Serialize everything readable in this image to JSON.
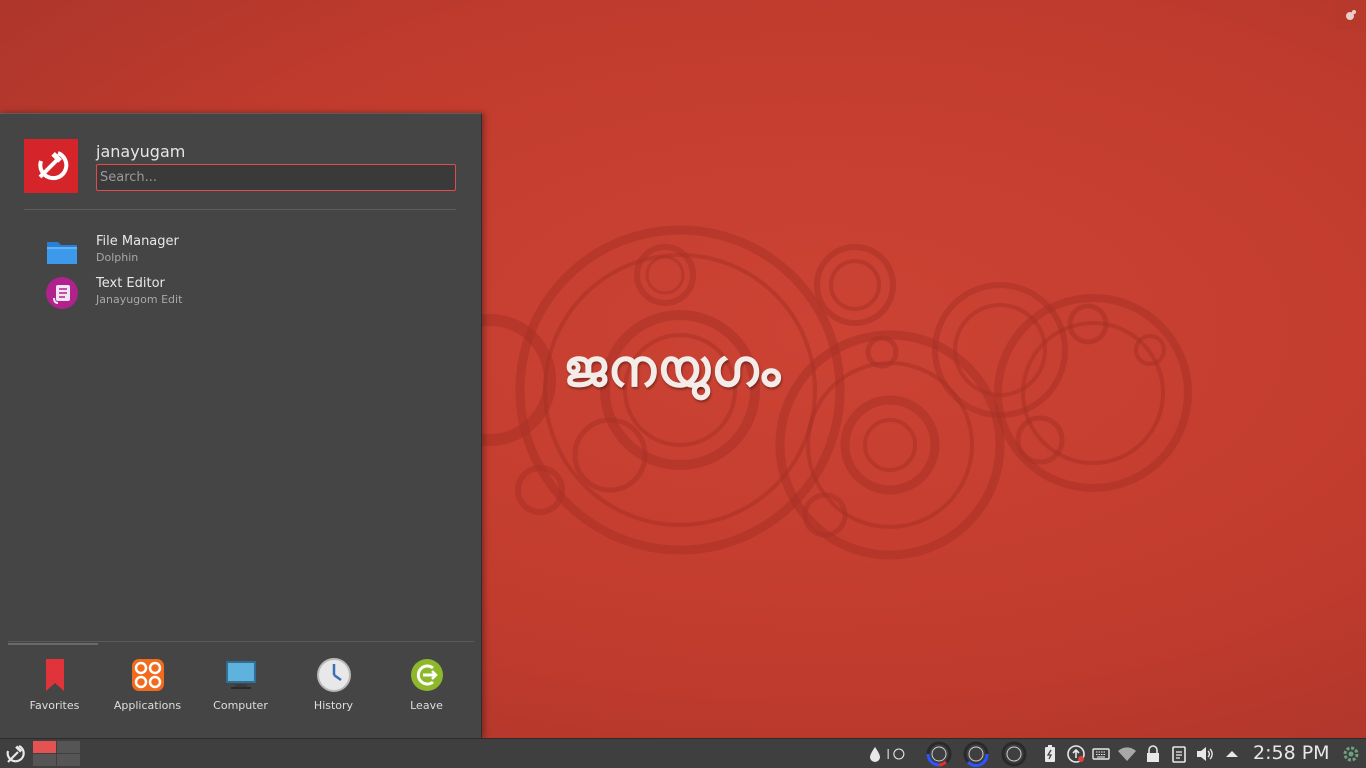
{
  "desktop": {
    "wallpaper_text": "ജനയുഗം"
  },
  "launcher": {
    "user_name": "janayugam",
    "search_placeholder": "Search...",
    "favorites": [
      {
        "name": "File Manager",
        "description": "Dolphin",
        "icon": "folder-icon"
      },
      {
        "name": "Text Editor",
        "description": "Janayugom Edit",
        "icon": "text-editor-icon"
      }
    ],
    "tabs": [
      {
        "label": "Favorites",
        "icon": "bookmark-icon"
      },
      {
        "label": "Applications",
        "icon": "applications-icon"
      },
      {
        "label": "Computer",
        "icon": "computer-icon"
      },
      {
        "label": "History",
        "icon": "clock-icon"
      },
      {
        "label": "Leave",
        "icon": "leave-icon"
      }
    ],
    "active_tab": "Favorites"
  },
  "panel": {
    "clock": "2:58 PM",
    "pager_active_desktop": 1
  },
  "colors": {
    "accent": "#e04b4b",
    "wallpaper": "#c8402f",
    "panel": "#3f3f3f",
    "launcher": "#454545"
  }
}
